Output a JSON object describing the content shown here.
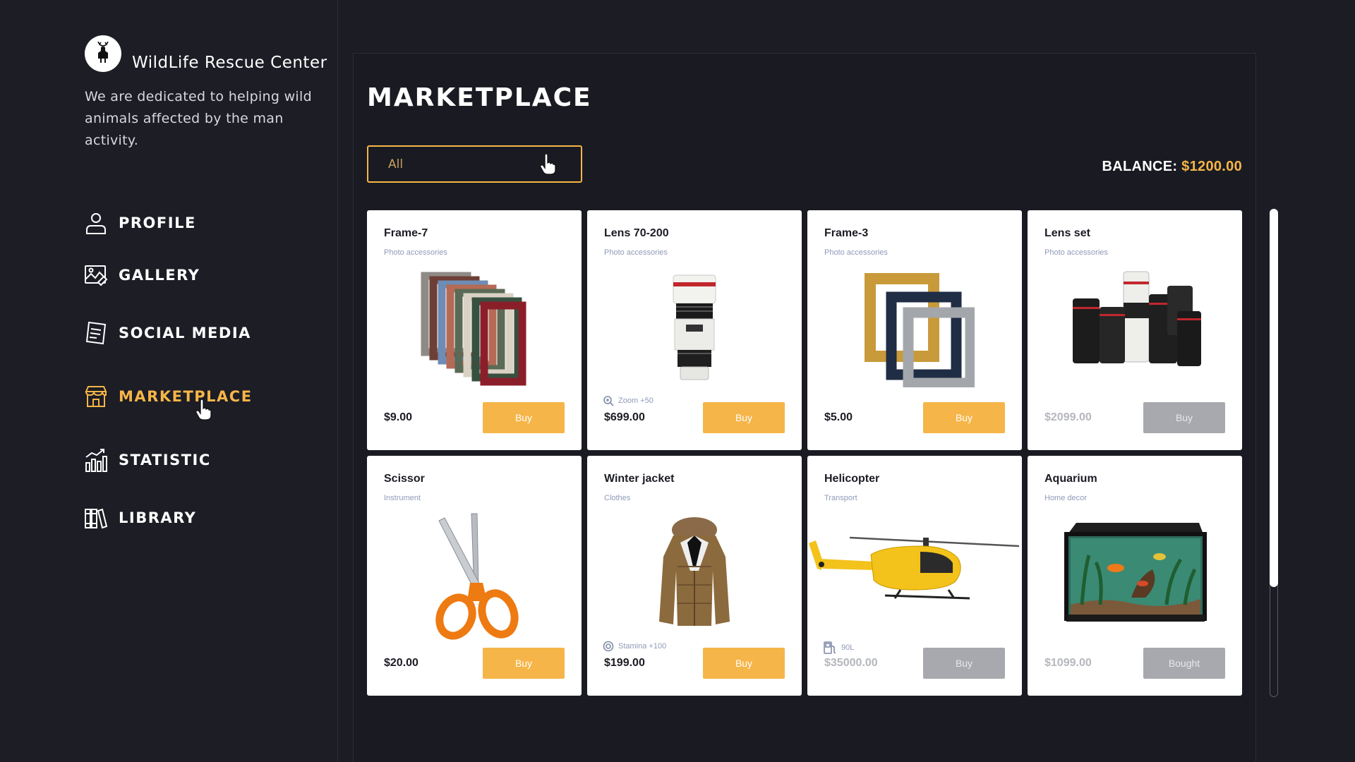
{
  "brand": {
    "title": "WildLife Rescue Center",
    "description": "We are dedicated to helping wild animals affected by the man activity.",
    "logo_icon": "deer-logo-icon"
  },
  "nav": {
    "items": [
      {
        "label": "PROFILE",
        "icon": "user-icon"
      },
      {
        "label": "GALLERY",
        "icon": "gallery-icon"
      },
      {
        "label": "SOCIAL MEDIA",
        "icon": "document-icon"
      },
      {
        "label": "MARKETPLACE",
        "icon": "store-icon",
        "active": true
      },
      {
        "label": "STATISTIC",
        "icon": "chart-icon"
      },
      {
        "label": "LIBRARY",
        "icon": "library-icon"
      }
    ]
  },
  "main": {
    "title": "MARKETPLACE",
    "filter_value": "All",
    "balance_label": "BALANCE:",
    "balance_value": "$1200.00"
  },
  "products": [
    {
      "name": "Frame-7",
      "category": "Photo accessories",
      "price": "$9.00",
      "button": "Buy",
      "stat": "",
      "state": "available"
    },
    {
      "name": "Lens 70-200",
      "category": "Photo accessories",
      "price": "$699.00",
      "button": "Buy",
      "stat": "Zoom +50",
      "state": "available"
    },
    {
      "name": "Frame-3",
      "category": "Photo accessories",
      "price": "$5.00",
      "button": "Buy",
      "stat": "",
      "state": "available"
    },
    {
      "name": "Lens set",
      "category": "Photo accessories",
      "price": "$2099.00",
      "button": "Buy",
      "stat": "",
      "state": "unaffordable"
    },
    {
      "name": "Scissor",
      "category": "Instrument",
      "price": "$20.00",
      "button": "Buy",
      "stat": "",
      "state": "available"
    },
    {
      "name": "Winter jacket",
      "category": "Clothes",
      "price": "$199.00",
      "button": "Buy",
      "stat": "Stamina +100",
      "state": "available"
    },
    {
      "name": "Helicopter",
      "category": "Transport",
      "price": "$35000.00",
      "button": "Buy",
      "stat": "90L",
      "state": "unaffordable"
    },
    {
      "name": "Aquarium",
      "category": "Home decor",
      "price": "$1099.00",
      "button": "Bought",
      "stat": "",
      "state": "bought"
    }
  ],
  "colors": {
    "accent": "#f6b548",
    "background": "#1b1c24",
    "disabled_button": "#a8a9ae"
  }
}
